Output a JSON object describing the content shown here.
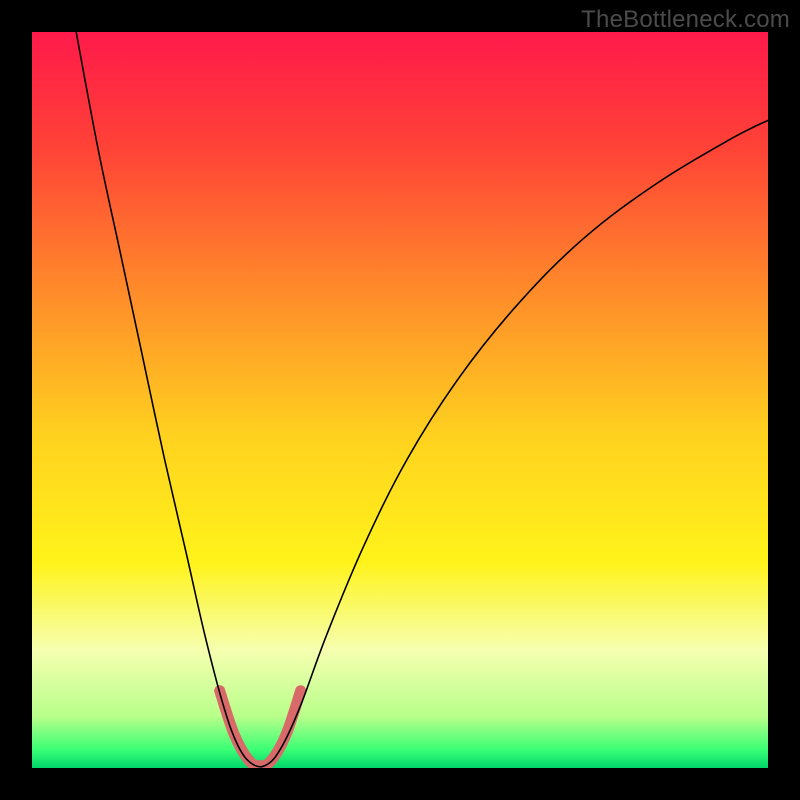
{
  "watermark": "TheBottleneck.com",
  "chart_data": {
    "type": "line",
    "title": "",
    "xlabel": "",
    "ylabel": "",
    "xlim": [
      0,
      100
    ],
    "ylim": [
      0,
      100
    ],
    "grid": false,
    "legend": false,
    "background_gradient_stops": [
      {
        "offset": 0.0,
        "color": "#ff1a4b"
      },
      {
        "offset": 0.15,
        "color": "#ff4037"
      },
      {
        "offset": 0.35,
        "color": "#ff8a2a"
      },
      {
        "offset": 0.55,
        "color": "#ffd21f"
      },
      {
        "offset": 0.72,
        "color": "#fff31a"
      },
      {
        "offset": 0.84,
        "color": "#f6ffb0"
      },
      {
        "offset": 0.93,
        "color": "#b8ff8a"
      },
      {
        "offset": 0.975,
        "color": "#3bff75"
      },
      {
        "offset": 1.0,
        "color": "#00d66b"
      }
    ],
    "series": [
      {
        "name": "curve",
        "stroke": "#000000",
        "stroke_width": 1.6,
        "points": [
          {
            "x": 6.0,
            "y": 100.0
          },
          {
            "x": 9.0,
            "y": 84.0
          },
          {
            "x": 12.0,
            "y": 70.0
          },
          {
            "x": 15.0,
            "y": 56.0
          },
          {
            "x": 18.0,
            "y": 42.0
          },
          {
            "x": 21.0,
            "y": 29.0
          },
          {
            "x": 23.5,
            "y": 18.0
          },
          {
            "x": 26.0,
            "y": 8.5
          },
          {
            "x": 28.0,
            "y": 3.0
          },
          {
            "x": 30.0,
            "y": 0.5
          },
          {
            "x": 32.0,
            "y": 0.5
          },
          {
            "x": 34.0,
            "y": 3.0
          },
          {
            "x": 36.5,
            "y": 8.5
          },
          {
            "x": 40.0,
            "y": 18.0
          },
          {
            "x": 45.0,
            "y": 30.0
          },
          {
            "x": 51.0,
            "y": 42.0
          },
          {
            "x": 58.0,
            "y": 53.0
          },
          {
            "x": 66.0,
            "y": 63.0
          },
          {
            "x": 75.0,
            "y": 72.0
          },
          {
            "x": 85.0,
            "y": 79.5
          },
          {
            "x": 95.0,
            "y": 85.5
          },
          {
            "x": 100.0,
            "y": 88.0
          }
        ]
      },
      {
        "name": "highlight",
        "stroke": "#d86a6a",
        "stroke_width": 11,
        "linecap": "round",
        "points": [
          {
            "x": 25.5,
            "y": 10.5
          },
          {
            "x": 27.5,
            "y": 4.5
          },
          {
            "x": 29.5,
            "y": 1.0
          },
          {
            "x": 31.0,
            "y": 0.3
          },
          {
            "x": 32.5,
            "y": 1.0
          },
          {
            "x": 34.5,
            "y": 4.5
          },
          {
            "x": 36.5,
            "y": 10.5
          }
        ]
      }
    ]
  }
}
